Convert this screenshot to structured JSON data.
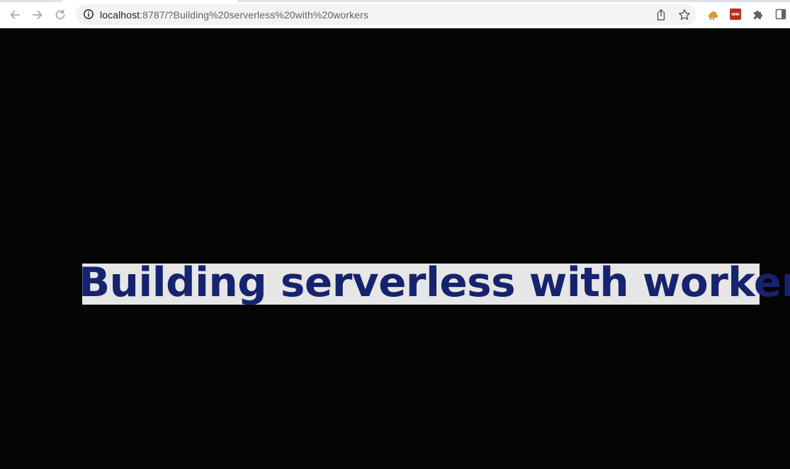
{
  "browser": {
    "url_host": "localhost",
    "url_path": ":8787/?Building%20serverless%20with%20workers",
    "buttons": {
      "back": "back-icon",
      "forward": "forward-icon",
      "reload": "reload-icon",
      "share": "share-icon",
      "bookmark": "star-icon"
    },
    "extensions": [
      "cloud-extension-icon",
      "password-manager-extension-icon",
      "puzzle-extensions-icon",
      "side-panel-icon"
    ]
  },
  "page": {
    "headline": "Building serverless with workers",
    "background_color": "#050505",
    "headline_color": "#16236e",
    "highlight_color": "#e6e6e6"
  }
}
